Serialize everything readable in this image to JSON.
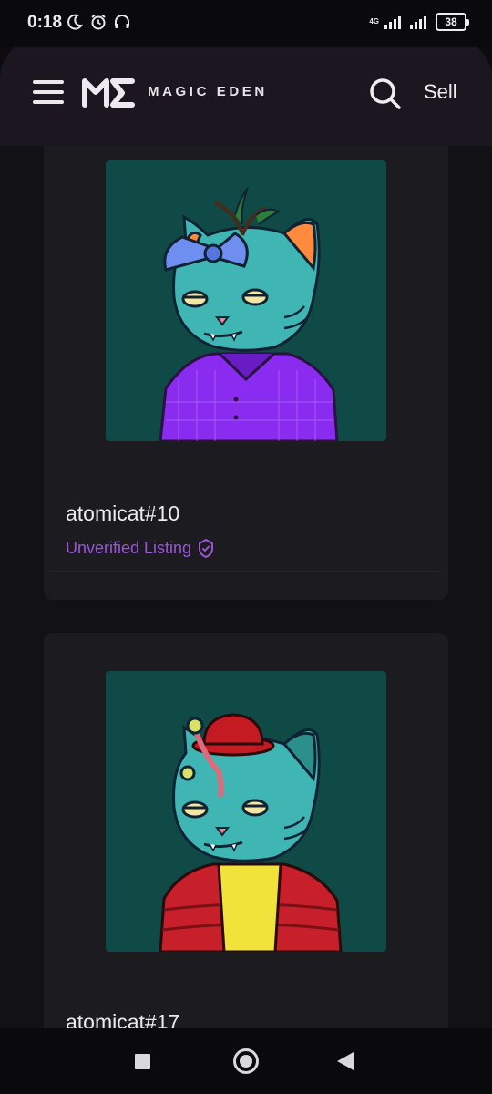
{
  "status_bar": {
    "time": "0:18",
    "network_label": "4G",
    "battery": "38"
  },
  "header": {
    "brand": "MAGIC EDEN",
    "sell_label": "Sell",
    "accent_color": "#9b55d8",
    "background_color": "#1b1620"
  },
  "listings": [
    {
      "name": "atomicat#10",
      "status": "Unverified Listing"
    },
    {
      "name": "atomicat#17"
    }
  ],
  "icons": {
    "menu": "hamburger-menu-icon",
    "search": "search-icon",
    "verified": "shield-check-icon",
    "nav_recent": "square-icon",
    "nav_home": "circle-icon",
    "nav_back": "triangle-back-icon"
  }
}
